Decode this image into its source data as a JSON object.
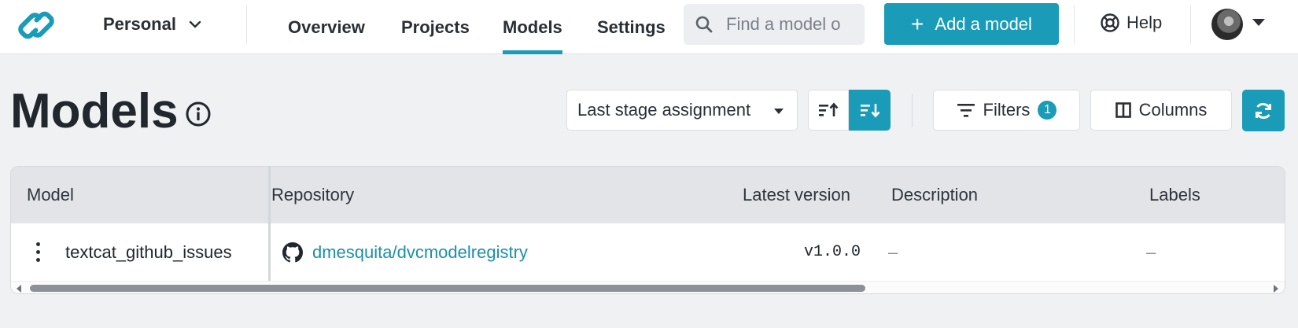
{
  "nav": {
    "workspace": "Personal",
    "links": [
      "Overview",
      "Projects",
      "Models",
      "Settings"
    ],
    "active_link": "Models",
    "search_placeholder": "Find a model o",
    "add_model_label": "Add a model",
    "help_label": "Help"
  },
  "page": {
    "title": "Models",
    "sort_by": "Last stage assignment",
    "filters_label": "Filters",
    "filters_count": "1",
    "columns_label": "Columns"
  },
  "table": {
    "headers": {
      "model": "Model",
      "repository": "Repository",
      "latest_version": "Latest version",
      "description": "Description",
      "labels": "Labels"
    },
    "rows": [
      {
        "model": "textcat_github_issues",
        "repository": "dmesquita/dvcmodelregistry",
        "latest_version": "v1.0.0",
        "description": "–",
        "labels": "–"
      }
    ]
  },
  "colors": {
    "accent": "#1a9bb8",
    "link": "#1a8fab",
    "background": "#f0f1f3"
  },
  "icons": [
    "logo-icon",
    "chevron-down-icon",
    "search-icon",
    "plus-icon",
    "help-lifebuoy-icon",
    "user-avatar",
    "info-icon",
    "sort-ascending-icon",
    "sort-descending-icon",
    "filter-icon",
    "columns-icon",
    "refresh-icon",
    "kebab-menu-icon",
    "github-icon"
  ]
}
